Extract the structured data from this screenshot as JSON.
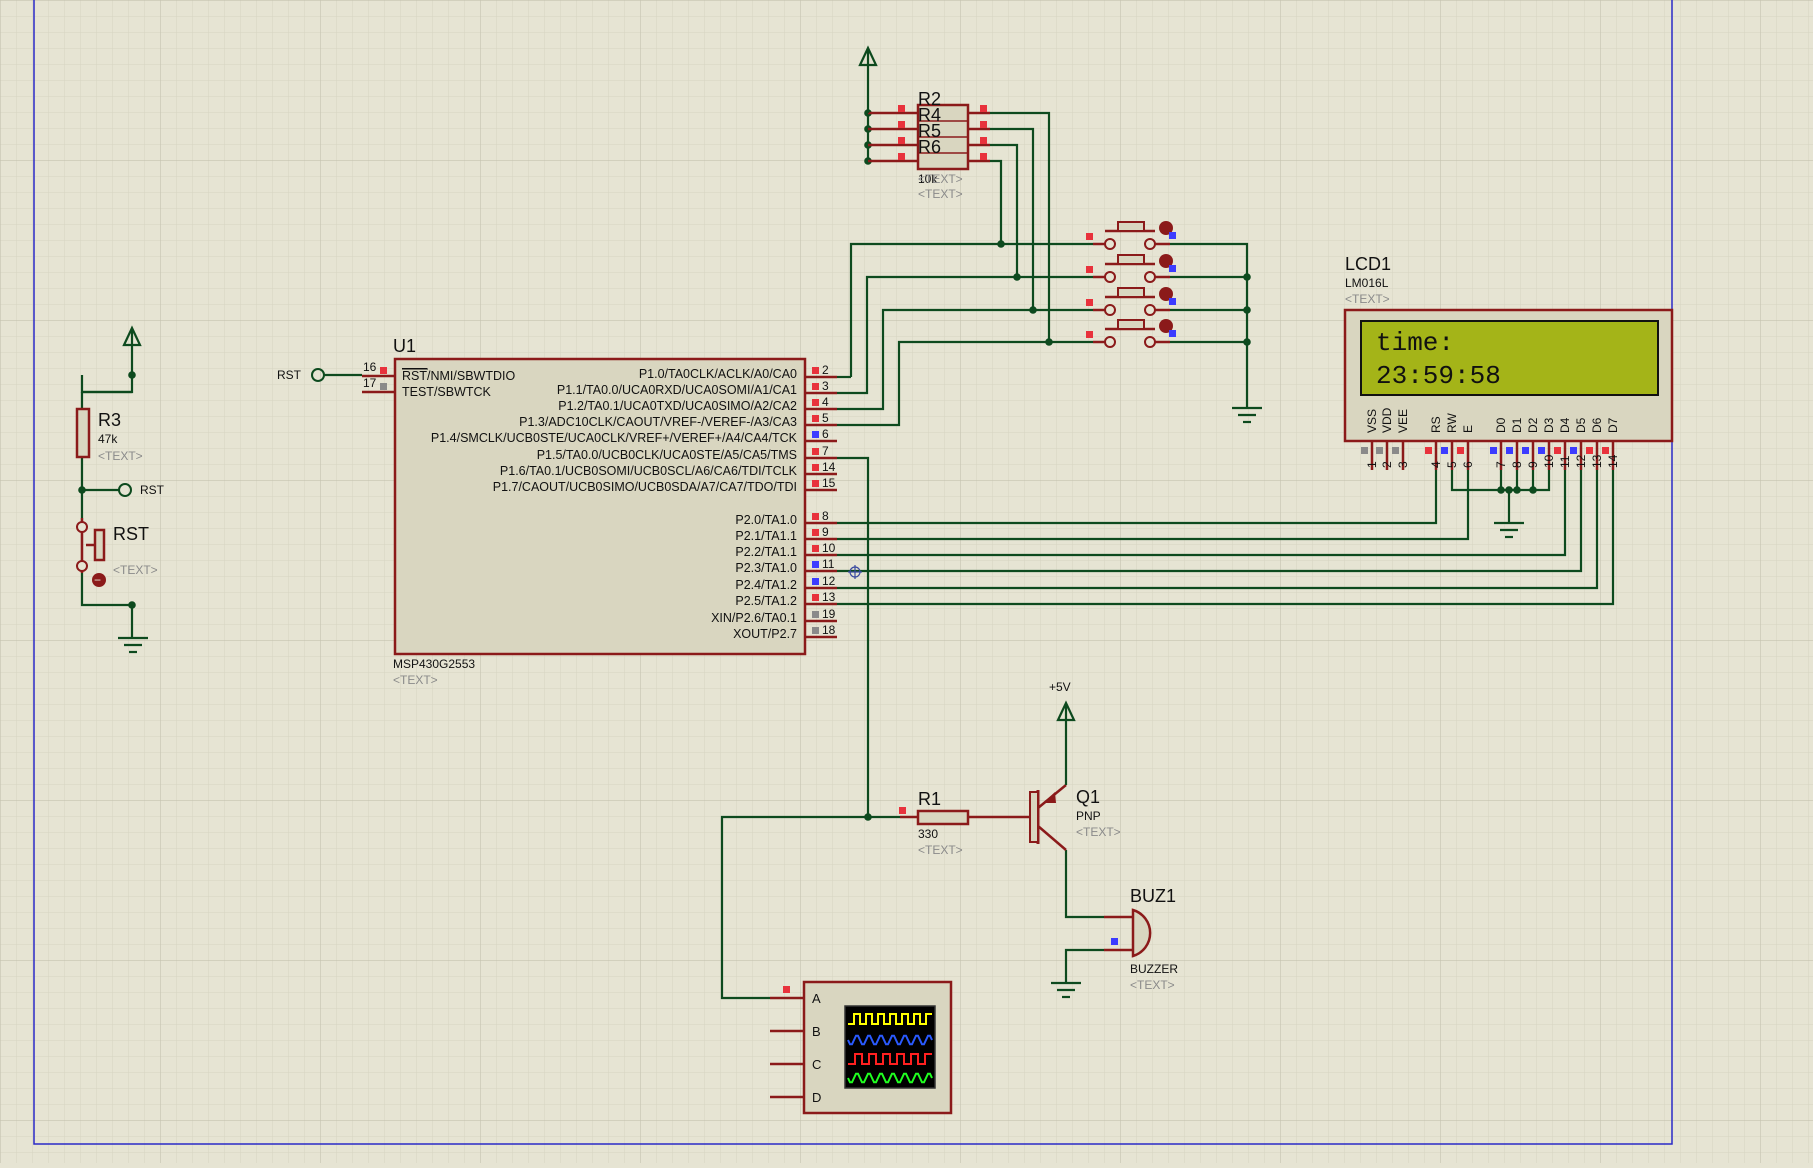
{
  "components": {
    "u1": {
      "ref": "U1",
      "part": "MSP430G2553",
      "text": "<TEXT>",
      "left_pins": [
        {
          "num": "16",
          "name": "RST/NMI/SBWTDIO",
          "overline": "RST",
          "rest": "/NMI/SBWTDIO",
          "net": "RST"
        },
        {
          "num": "17",
          "name": "TEST/SBWTCK"
        }
      ],
      "right_pins": [
        {
          "num": "2",
          "name": "P1.0/TA0CLK/ACLK/A0/CA0"
        },
        {
          "num": "3",
          "name": "P1.1/TA0.0/UCA0RXD/UCA0SOMI/A1/CA1"
        },
        {
          "num": "4",
          "name": "P1.2/TA0.1/UCA0TXD/UCA0SIMO/A2/CA2"
        },
        {
          "num": "5",
          "name": "P1.3/ADC10CLK/CAOUT/VREF-/VEREF-/A3/CA3"
        },
        {
          "num": "6",
          "name": "P1.4/SMCLK/UCB0STE/UCA0CLK/VREF+/VEREF+/A4/CA4/TCK"
        },
        {
          "num": "7",
          "name": "P1.5/TA0.0/UCB0CLK/UCA0STE/A5/CA5/TMS"
        },
        {
          "num": "14",
          "name": "P1.6/TA0.1/UCB0SOMI/UCB0SCL/A6/CA6/TDI/TCLK"
        },
        {
          "num": "15",
          "name": "P1.7/CAOUT/UCB0SIMO/UCB0SDA/A7/CA7/TDO/TDI"
        },
        {
          "num": "8",
          "name": "P2.0/TA1.0"
        },
        {
          "num": "9",
          "name": "P2.1/TA1.1"
        },
        {
          "num": "10",
          "name": "P2.2/TA1.1"
        },
        {
          "num": "11",
          "name": "P2.3/TA1.0"
        },
        {
          "num": "12",
          "name": "P2.4/TA1.2"
        },
        {
          "num": "13",
          "name": "P2.5/TA1.2"
        },
        {
          "num": "19",
          "name": "XIN/P2.6/TA0.1"
        },
        {
          "num": "18",
          "name": "XOUT/P2.7"
        }
      ]
    },
    "resistor_array": {
      "refs": [
        "R2",
        "R4",
        "R5",
        "R6"
      ],
      "value": "10k",
      "text_lines": [
        "<TEXT>",
        "<TEXT>"
      ]
    },
    "r1": {
      "ref": "R1",
      "value": "330",
      "text": "<TEXT>"
    },
    "r3": {
      "ref": "R3",
      "value": "47k",
      "text": "<TEXT>"
    },
    "rst_button": {
      "ref": "RST",
      "text": "<TEXT>"
    },
    "rst_terminals": [
      "RST",
      "RST"
    ],
    "q1": {
      "ref": "Q1",
      "type": "PNP",
      "text": "<TEXT>"
    },
    "supply": {
      "label": "+5V"
    },
    "buzzer": {
      "ref": "BUZ1",
      "part": "BUZZER",
      "text": "<TEXT>"
    },
    "lcd": {
      "ref": "LCD1",
      "part": "LM016L",
      "text": "<TEXT>",
      "line1": "time:",
      "line2": "23:59:58",
      "pin_names": [
        "VSS",
        "VDD",
        "VEE",
        "RS",
        "RW",
        "E",
        "D0",
        "D1",
        "D2",
        "D3",
        "D4",
        "D5",
        "D6",
        "D7"
      ],
      "pin_nums": [
        "1",
        "2",
        "3",
        "4",
        "5",
        "6",
        "7",
        "8",
        "9",
        "10",
        "11",
        "12",
        "13",
        "14"
      ]
    },
    "scope": {
      "channels": [
        "A",
        "B",
        "C",
        "D"
      ]
    }
  },
  "colors": {
    "background": "#e6e4d3",
    "grid_minor": "#d6d4c2",
    "grid_major": "#c5c3b0",
    "border": "#2a2ac8",
    "component": "#8b1a1a",
    "body_fill": "#d9d6c0",
    "wire": "#0d4a1e",
    "pin_red": "#e8323c",
    "pin_blue": "#3c3cff",
    "pin_gray": "#8a8a8a",
    "lcd_screen": "#a4b418",
    "trace_yellow": "#ffff00",
    "trace_blue": "#2a5aff",
    "trace_red": "#ff2020",
    "trace_green": "#20ff20"
  }
}
